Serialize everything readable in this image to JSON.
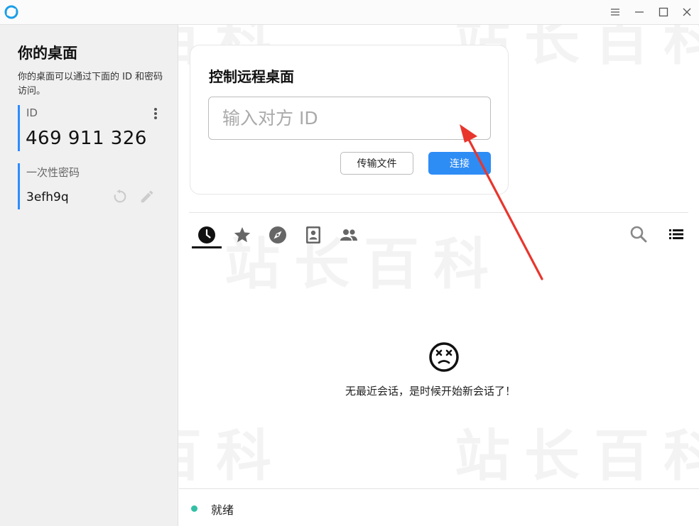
{
  "window": {
    "controls": [
      "menu-icon",
      "minimize-icon",
      "maximize-icon",
      "close-icon"
    ]
  },
  "sidebar": {
    "title": "你的桌面",
    "description": "你的桌面可以通过下面的 ID 和密码访问。",
    "id_label": "ID",
    "id_value": "469 911 326",
    "password_label": "一次性密码",
    "password_value": "3efh9q"
  },
  "connect_card": {
    "title": "控制远程桌面",
    "input_placeholder": "输入对方 ID",
    "transfer_label": "传输文件",
    "connect_label": "连接"
  },
  "tabs": [
    {
      "icon": "clock-icon",
      "active": true
    },
    {
      "icon": "star-icon",
      "active": false
    },
    {
      "icon": "compass-icon",
      "active": false
    },
    {
      "icon": "address-book-icon",
      "active": false
    },
    {
      "icon": "group-icon",
      "active": false
    }
  ],
  "empty_state": {
    "icon": "dizzy-face-icon",
    "message": "无最近会话，是时候开始新会话了！"
  },
  "status": {
    "text": "就绪",
    "color": "#32bfa5"
  },
  "watermark": "站长百科",
  "colors": {
    "accent": "#2e8cf5",
    "arrow": "#e8362d"
  }
}
